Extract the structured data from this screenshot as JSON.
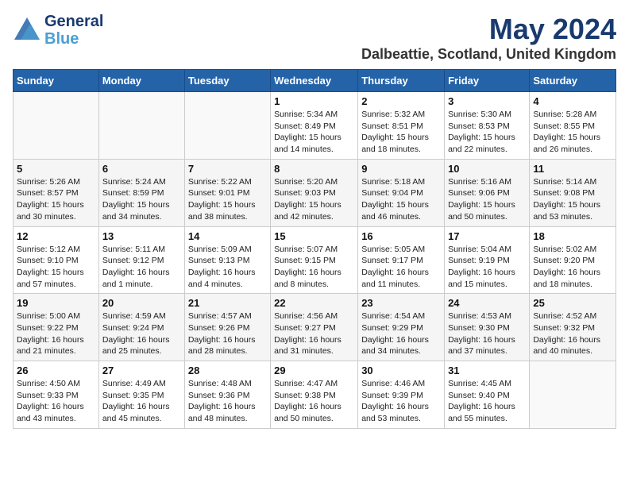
{
  "header": {
    "logo_line1": "General",
    "logo_line2": "Blue",
    "title": "May 2024",
    "subtitle": "Dalbeattie, Scotland, United Kingdom"
  },
  "weekdays": [
    "Sunday",
    "Monday",
    "Tuesday",
    "Wednesday",
    "Thursday",
    "Friday",
    "Saturday"
  ],
  "weeks": [
    [
      {
        "day": "",
        "info": ""
      },
      {
        "day": "",
        "info": ""
      },
      {
        "day": "",
        "info": ""
      },
      {
        "day": "1",
        "info": "Sunrise: 5:34 AM\nSunset: 8:49 PM\nDaylight: 15 hours\nand 14 minutes."
      },
      {
        "day": "2",
        "info": "Sunrise: 5:32 AM\nSunset: 8:51 PM\nDaylight: 15 hours\nand 18 minutes."
      },
      {
        "day": "3",
        "info": "Sunrise: 5:30 AM\nSunset: 8:53 PM\nDaylight: 15 hours\nand 22 minutes."
      },
      {
        "day": "4",
        "info": "Sunrise: 5:28 AM\nSunset: 8:55 PM\nDaylight: 15 hours\nand 26 minutes."
      }
    ],
    [
      {
        "day": "5",
        "info": "Sunrise: 5:26 AM\nSunset: 8:57 PM\nDaylight: 15 hours\nand 30 minutes."
      },
      {
        "day": "6",
        "info": "Sunrise: 5:24 AM\nSunset: 8:59 PM\nDaylight: 15 hours\nand 34 minutes."
      },
      {
        "day": "7",
        "info": "Sunrise: 5:22 AM\nSunset: 9:01 PM\nDaylight: 15 hours\nand 38 minutes."
      },
      {
        "day": "8",
        "info": "Sunrise: 5:20 AM\nSunset: 9:03 PM\nDaylight: 15 hours\nand 42 minutes."
      },
      {
        "day": "9",
        "info": "Sunrise: 5:18 AM\nSunset: 9:04 PM\nDaylight: 15 hours\nand 46 minutes."
      },
      {
        "day": "10",
        "info": "Sunrise: 5:16 AM\nSunset: 9:06 PM\nDaylight: 15 hours\nand 50 minutes."
      },
      {
        "day": "11",
        "info": "Sunrise: 5:14 AM\nSunset: 9:08 PM\nDaylight: 15 hours\nand 53 minutes."
      }
    ],
    [
      {
        "day": "12",
        "info": "Sunrise: 5:12 AM\nSunset: 9:10 PM\nDaylight: 15 hours\nand 57 minutes."
      },
      {
        "day": "13",
        "info": "Sunrise: 5:11 AM\nSunset: 9:12 PM\nDaylight: 16 hours\nand 1 minute."
      },
      {
        "day": "14",
        "info": "Sunrise: 5:09 AM\nSunset: 9:13 PM\nDaylight: 16 hours\nand 4 minutes."
      },
      {
        "day": "15",
        "info": "Sunrise: 5:07 AM\nSunset: 9:15 PM\nDaylight: 16 hours\nand 8 minutes."
      },
      {
        "day": "16",
        "info": "Sunrise: 5:05 AM\nSunset: 9:17 PM\nDaylight: 16 hours\nand 11 minutes."
      },
      {
        "day": "17",
        "info": "Sunrise: 5:04 AM\nSunset: 9:19 PM\nDaylight: 16 hours\nand 15 minutes."
      },
      {
        "day": "18",
        "info": "Sunrise: 5:02 AM\nSunset: 9:20 PM\nDaylight: 16 hours\nand 18 minutes."
      }
    ],
    [
      {
        "day": "19",
        "info": "Sunrise: 5:00 AM\nSunset: 9:22 PM\nDaylight: 16 hours\nand 21 minutes."
      },
      {
        "day": "20",
        "info": "Sunrise: 4:59 AM\nSunset: 9:24 PM\nDaylight: 16 hours\nand 25 minutes."
      },
      {
        "day": "21",
        "info": "Sunrise: 4:57 AM\nSunset: 9:26 PM\nDaylight: 16 hours\nand 28 minutes."
      },
      {
        "day": "22",
        "info": "Sunrise: 4:56 AM\nSunset: 9:27 PM\nDaylight: 16 hours\nand 31 minutes."
      },
      {
        "day": "23",
        "info": "Sunrise: 4:54 AM\nSunset: 9:29 PM\nDaylight: 16 hours\nand 34 minutes."
      },
      {
        "day": "24",
        "info": "Sunrise: 4:53 AM\nSunset: 9:30 PM\nDaylight: 16 hours\nand 37 minutes."
      },
      {
        "day": "25",
        "info": "Sunrise: 4:52 AM\nSunset: 9:32 PM\nDaylight: 16 hours\nand 40 minutes."
      }
    ],
    [
      {
        "day": "26",
        "info": "Sunrise: 4:50 AM\nSunset: 9:33 PM\nDaylight: 16 hours\nand 43 minutes."
      },
      {
        "day": "27",
        "info": "Sunrise: 4:49 AM\nSunset: 9:35 PM\nDaylight: 16 hours\nand 45 minutes."
      },
      {
        "day": "28",
        "info": "Sunrise: 4:48 AM\nSunset: 9:36 PM\nDaylight: 16 hours\nand 48 minutes."
      },
      {
        "day": "29",
        "info": "Sunrise: 4:47 AM\nSunset: 9:38 PM\nDaylight: 16 hours\nand 50 minutes."
      },
      {
        "day": "30",
        "info": "Sunrise: 4:46 AM\nSunset: 9:39 PM\nDaylight: 16 hours\nand 53 minutes."
      },
      {
        "day": "31",
        "info": "Sunrise: 4:45 AM\nSunset: 9:40 PM\nDaylight: 16 hours\nand 55 minutes."
      },
      {
        "day": "",
        "info": ""
      }
    ]
  ]
}
